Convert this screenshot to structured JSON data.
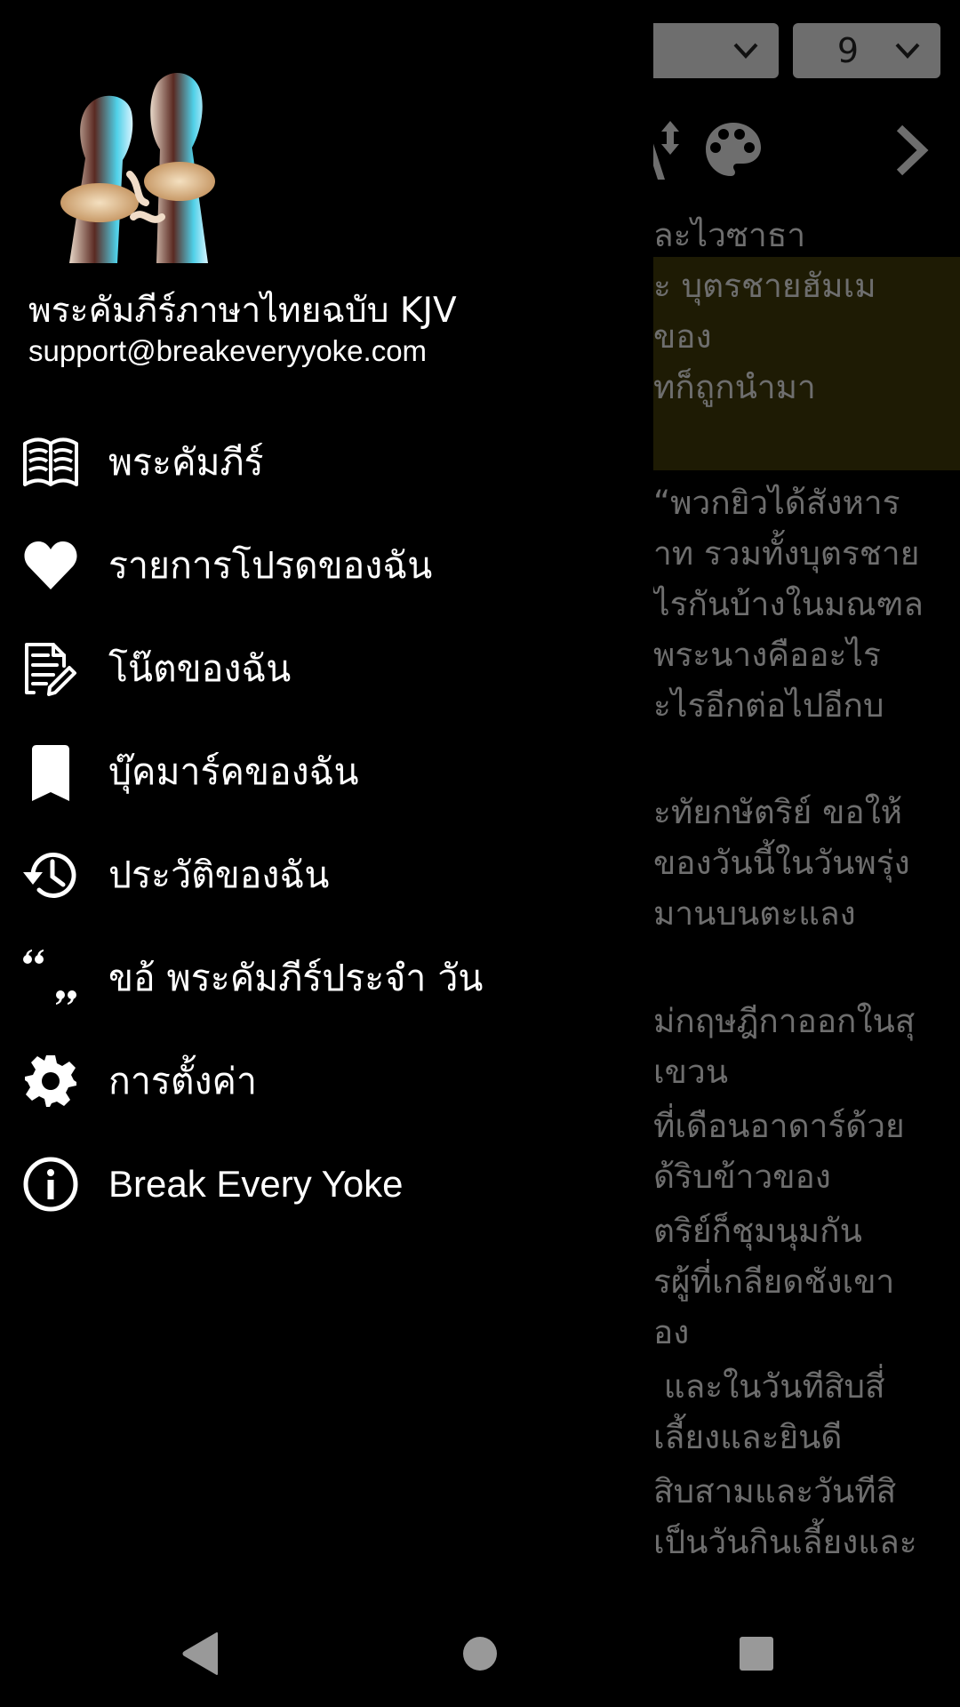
{
  "background_reader": {
    "book_dropdown": {
      "value": "",
      "icon": "chevron-down-icon"
    },
    "chapter_dropdown": {
      "value": "9",
      "icon": "chevron-down-icon"
    },
    "toolbar": {
      "icons": [
        "font-size-icon",
        "palette-icon",
        "chevron-right-icon"
      ]
    },
    "colors": {
      "dropdown_bg": "#6e6e6e",
      "highlight_bg": "#1e1b04",
      "dim_text": "#6e6e6e"
    },
    "verse_lines": [
      {
        "text": "ละไวซาธา",
        "top": 0
      },
      {
        "text": "ะ บุตรชายฮัมเม",
        "highlight": true
      },
      {
        "text": "ของ",
        "highlight": true
      },
      {
        "text": "ทก็ถูกนำมา",
        "highlight": true
      },
      {
        "text": "“พวกยิวได้สังหาร"
      },
      {
        "text": "าท รวมทั้งบุตรชาย"
      },
      {
        "text": "ไรกันบ้างในมณฑล"
      },
      {
        "text": "พระนางคืออะไร"
      },
      {
        "text": "ะไรอีกต่อไปอีกบ"
      },
      {
        "text": "ะทัยกษัตริย์ ขอให้"
      },
      {
        "text": "ของวันนี้ในวันพรุ่ง"
      },
      {
        "text": "มานบนตะแลง"
      },
      {
        "text": "ม่กฤษฎีกาออกในสุ"
      },
      {
        "text": "เขวน"
      },
      {
        "text": "ที่เดือนอาดาร์ด้วย"
      },
      {
        "text": "ด้ริบข้าวของ"
      },
      {
        "text": "ตริย์ก็ชุมนุมกัน"
      },
      {
        "text": "รผู้ที่เกลียดชังเขา"
      },
      {
        "text": "อง"
      },
      {
        "text": "่ และในวันทีสิบสี่"
      },
      {
        "text": "เลี้ยงและยินดี"
      },
      {
        "text": "สิบสามและวันทีสิ"
      },
      {
        "text": "เป็นวันกินเลี้ยงและ"
      }
    ]
  },
  "drawer": {
    "header": {
      "logo": "bound-hands-breaking-rope-logo",
      "title": "พระคัมภีร์ภาษาไทยฉบับ KJV",
      "email": "support@breakeveryyoke.com"
    },
    "menu": [
      {
        "icon": "bible-book-icon",
        "label": "พระคัมภีร์"
      },
      {
        "icon": "heart-icon",
        "label": "รายการโปรดของฉัน"
      },
      {
        "icon": "notes-edit-icon",
        "label": "โน๊ตของฉัน"
      },
      {
        "icon": "bookmark-icon",
        "label": "บุ๊คมาร์คของฉัน"
      },
      {
        "icon": "history-icon",
        "label": "ประวัติของฉัน"
      },
      {
        "icon": "quote-icon",
        "label": "ขอ้ พระคัมภีร์ประจำ วัน"
      },
      {
        "icon": "gear-icon",
        "label": "การตั้งค่า"
      },
      {
        "icon": "info-icon",
        "label": "Break Every Yoke"
      }
    ]
  },
  "navbar": {
    "buttons": [
      "back-icon",
      "home-icon",
      "recents-icon"
    ],
    "color": "#999999"
  }
}
